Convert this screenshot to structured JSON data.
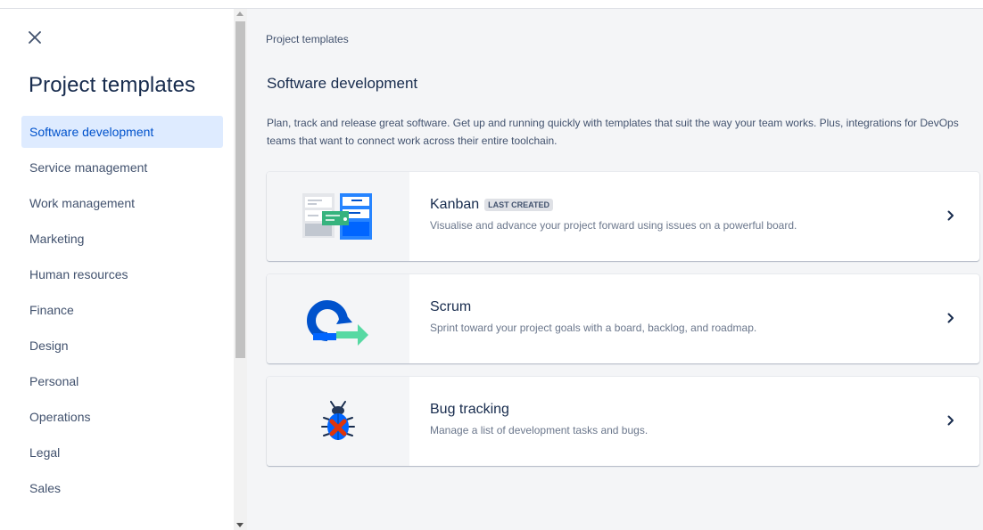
{
  "sidebar": {
    "close_label": "Close",
    "title": "Project templates",
    "items": [
      {
        "label": "Software development",
        "active": true
      },
      {
        "label": "Service management"
      },
      {
        "label": "Work management"
      },
      {
        "label": "Marketing"
      },
      {
        "label": "Human resources"
      },
      {
        "label": "Finance"
      },
      {
        "label": "Design"
      },
      {
        "label": "Personal"
      },
      {
        "label": "Operations"
      },
      {
        "label": "Legal"
      },
      {
        "label": "Sales"
      }
    ]
  },
  "main": {
    "breadcrumb": "Project templates",
    "section_title": "Software development",
    "section_description": "Plan, track and release great software. Get up and running quickly with templates that suit the way your team works. Plus, integrations for DevOps teams that want to connect work across their entire toolchain.",
    "templates": [
      {
        "title": "Kanban",
        "badge": "LAST CREATED",
        "description": "Visualise and advance your project forward using issues on a powerful board.",
        "icon": "kanban-board-icon"
      },
      {
        "title": "Scrum",
        "description": "Sprint toward your project goals with a board, backlog, and roadmap.",
        "icon": "scrum-cycle-icon"
      },
      {
        "title": "Bug tracking",
        "description": "Manage a list of development tasks and bugs.",
        "icon": "bug-icon"
      }
    ]
  },
  "colors": {
    "accent": "#0052cc",
    "active_bg": "#deebff",
    "main_bg": "#f4f5f7",
    "text_primary": "#172b4d",
    "text_secondary": "#42526e"
  }
}
